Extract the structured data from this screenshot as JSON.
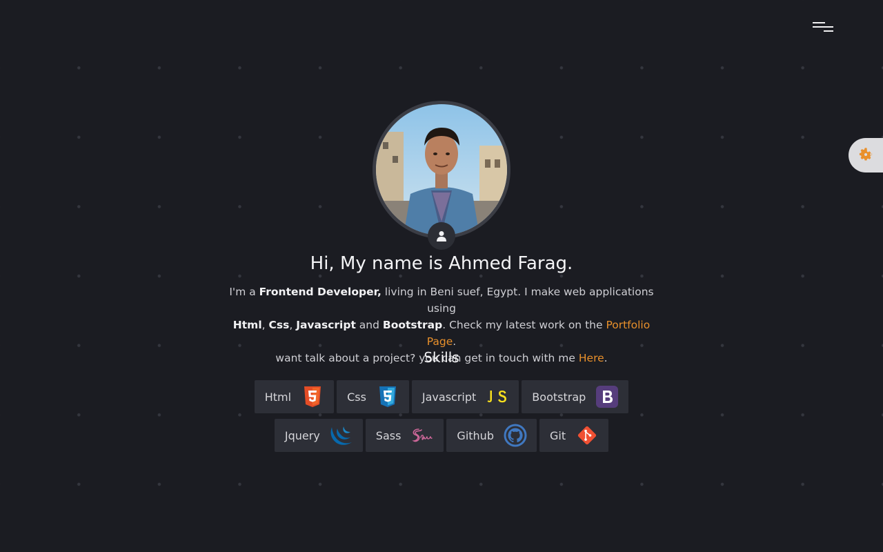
{
  "header": {
    "menu_icon": "hamburger-menu-icon",
    "settings_icon": "gear-icon"
  },
  "profile": {
    "avatar_icon": "user-icon",
    "greeting": "Hi, My name is Ahmed Farag.",
    "bio": {
      "p1": "I'm a ",
      "role": "Frontend Developer,",
      "p2": " living in Beni suef, Egypt. I make web applications using ",
      "s1": "Html",
      "sep1": ", ",
      "s2": "Css",
      "sep2": ", ",
      "s3": "Javascript",
      "p3": " and ",
      "s4": "Bootstrap",
      "p4": ". Check my latest work on the ",
      "portfolio_link": "Portfolio Page",
      "p5": ".",
      "p6": "want talk about a project? you can get in touch with me ",
      "here_link": "Here",
      "p7": "."
    }
  },
  "skills": {
    "title": "Skills",
    "row1": [
      {
        "label": "Html",
        "icon": "html5-icon",
        "color": "#e44d26"
      },
      {
        "label": "Css",
        "icon": "css3-icon",
        "color": "#1572b6"
      },
      {
        "label": "Javascript",
        "icon": "javascript-icon",
        "color": "#f7df1e"
      },
      {
        "label": "Bootstrap",
        "icon": "bootstrap-icon",
        "color": "#563d7c"
      }
    ],
    "row2": [
      {
        "label": "Jquery",
        "icon": "jquery-icon",
        "color": "#0769ad"
      },
      {
        "label": "Sass",
        "icon": "sass-icon",
        "color": "#cd6799"
      },
      {
        "label": "Github",
        "icon": "github-icon",
        "color": "#4078c0"
      },
      {
        "label": "Git",
        "icon": "git-icon",
        "color": "#f05033"
      }
    ]
  },
  "colors": {
    "background": "#1b1c22",
    "accent": "#e9902b",
    "card": "#2d2f37"
  }
}
